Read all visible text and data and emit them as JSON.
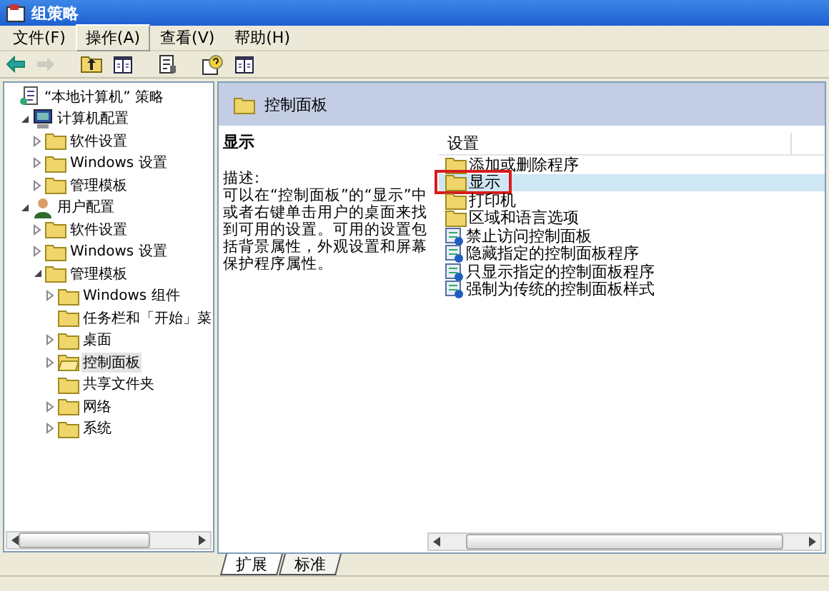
{
  "window": {
    "title": "组策略"
  },
  "menu": [
    {
      "label": "文件(F)",
      "selected": false
    },
    {
      "label": "操作(A)",
      "selected": true
    },
    {
      "label": "查看(V)",
      "selected": false
    },
    {
      "label": "帮助(H)",
      "selected": false
    }
  ],
  "toolbar": [
    {
      "kind": "back",
      "disabled": false
    },
    {
      "kind": "forward",
      "disabled": true
    },
    {
      "kind": "up",
      "disabled": false
    },
    {
      "kind": "pane",
      "disabled": false
    },
    {
      "kind": "properties",
      "disabled": false
    },
    {
      "kind": "help",
      "disabled": false
    },
    {
      "kind": "pane",
      "disabled": false
    }
  ],
  "tree": [
    {
      "label": "“本地计算机” 策略",
      "kind": "policy",
      "selected": false,
      "children": [
        {
          "label": "计算机配置",
          "kind": "computer",
          "selected": false,
          "expanded": true,
          "children": [
            {
              "label": "软件设置",
              "kind": "folder",
              "selected": false,
              "expanded": false
            },
            {
              "label": "Windows 设置",
              "kind": "folder",
              "selected": false,
              "expanded": false
            },
            {
              "label": "管理模板",
              "kind": "folder",
              "selected": false,
              "expanded": false
            }
          ]
        },
        {
          "label": "用户配置",
          "kind": "user",
          "selected": false,
          "expanded": true,
          "children": [
            {
              "label": "软件设置",
              "kind": "folder",
              "selected": false,
              "expanded": false
            },
            {
              "label": "Windows 设置",
              "kind": "folder",
              "selected": false,
              "expanded": false
            },
            {
              "label": "管理模板",
              "kind": "folder",
              "selected": false,
              "expanded": true,
              "children": [
                {
                  "label": "Windows 组件",
                  "kind": "folder",
                  "selected": false,
                  "expanded": false
                },
                {
                  "label": "任务栏和「开始」菜",
                  "kind": "folder",
                  "selected": false
                },
                {
                  "label": "桌面",
                  "kind": "folder",
                  "selected": false,
                  "expanded": false
                },
                {
                  "label": "控制面板",
                  "kind": "folder",
                  "selected": true,
                  "expanded": false
                },
                {
                  "label": "共享文件夹",
                  "kind": "folder",
                  "selected": false
                },
                {
                  "label": "网络",
                  "kind": "folder",
                  "selected": false,
                  "expanded": false
                },
                {
                  "label": "系统",
                  "kind": "folder",
                  "selected": false,
                  "expanded": false
                }
              ]
            }
          ]
        }
      ]
    }
  ],
  "details": {
    "header": "控制面板",
    "title": "显示",
    "description_label": "描述:",
    "description": "可以在“控制面板”的“显示”中或者右键单击用户的桌面来找到可用的设置。可用的设置包括背景属性，外观设置和屏幕保护程序属性。",
    "columns": [
      "设置"
    ],
    "rows": [
      {
        "label": "添加或删除程序",
        "kind": "folder",
        "selected": false,
        "annotated": false
      },
      {
        "label": "显示",
        "kind": "folder",
        "selected": true,
        "annotated": true
      },
      {
        "label": "打印机",
        "kind": "folder",
        "selected": false,
        "annotated": false
      },
      {
        "label": "区域和语言选项",
        "kind": "folder",
        "selected": false,
        "annotated": false
      },
      {
        "label": "禁止访问控制面板",
        "kind": "setting",
        "selected": false,
        "annotated": false
      },
      {
        "label": "隐藏指定的控制面板程序",
        "kind": "setting",
        "selected": false,
        "annotated": false
      },
      {
        "label": "只显示指定的控制面板程序",
        "kind": "setting",
        "selected": false,
        "annotated": false
      },
      {
        "label": "强制为传统的控制面板样式",
        "kind": "setting",
        "selected": false,
        "annotated": false
      }
    ]
  },
  "tabs": [
    {
      "label": "扩展",
      "selected": true
    },
    {
      "label": "标准",
      "selected": false
    }
  ]
}
